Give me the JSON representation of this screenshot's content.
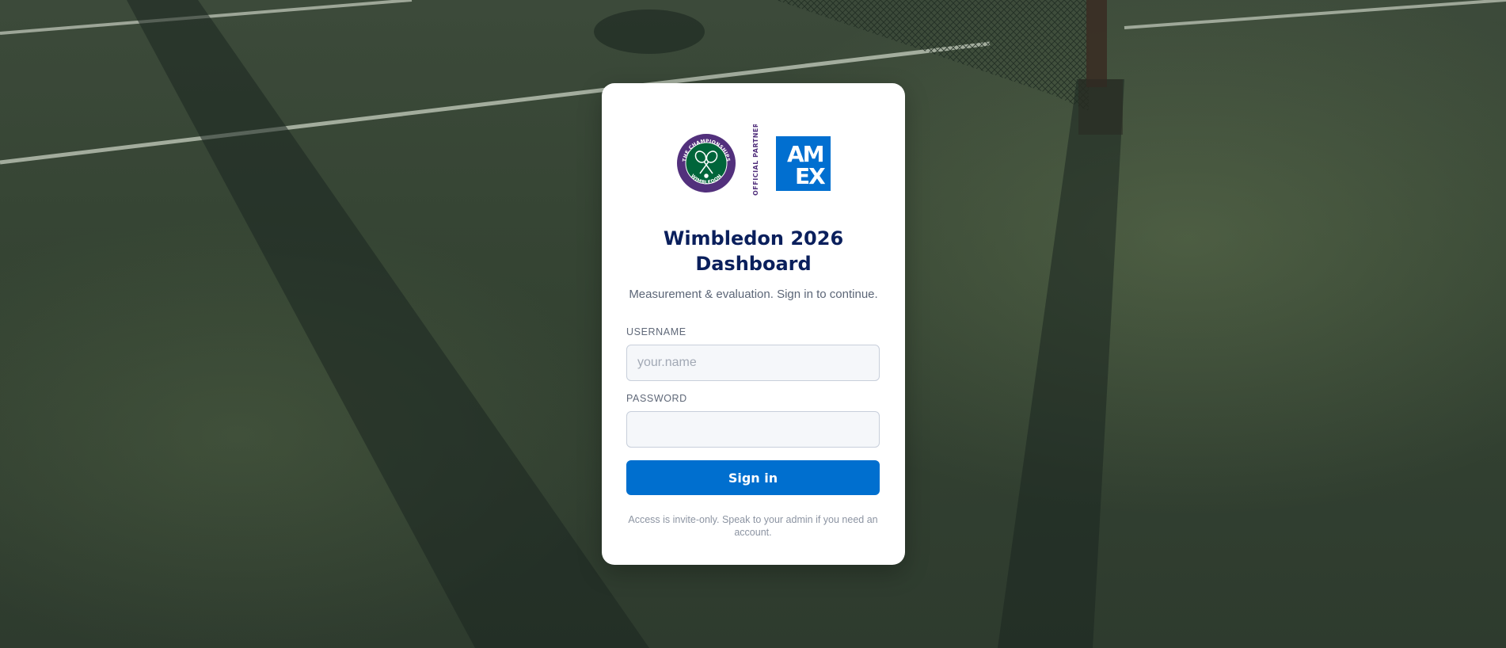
{
  "login": {
    "title": "Wimbledon 2026 Dashboard",
    "subtitle": "Measurement & evaluation. Sign in to continue.",
    "username_label": "USERNAME",
    "username_placeholder": "your.name",
    "username_value": "",
    "password_label": "PASSWORD",
    "password_value": "",
    "signin_label": "Sign in",
    "footnote": "Access is invite-only. Speak to your admin if you need an account."
  },
  "logos": {
    "wimbledon_top_text": "THE CHAMPIONSHIPS",
    "wimbledon_bottom_text": "WIMBLEDON",
    "partner_text": "OFFICIAL PARTNER",
    "amex_line1": "AM",
    "amex_line2": "EX",
    "wimbledon_icon": "crossed-rackets-icon"
  },
  "colors": {
    "wimbledon_purple": "#52307c",
    "wimbledon_green": "#00653a",
    "amex_blue": "#016fd0",
    "title_navy": "#0a1f5c",
    "button_blue": "#006fcf"
  }
}
